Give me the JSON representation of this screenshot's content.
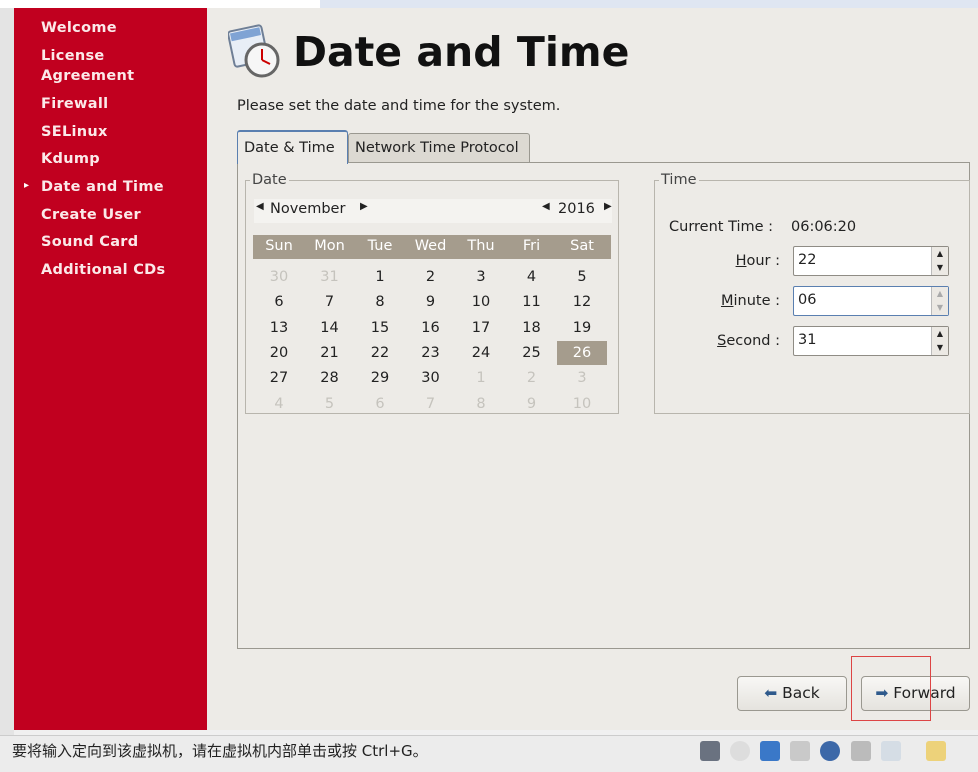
{
  "sidebar": {
    "items": [
      {
        "label": "Welcome"
      },
      {
        "label": "License Agreement"
      },
      {
        "label": "Firewall"
      },
      {
        "label": "SELinux"
      },
      {
        "label": "Kdump"
      },
      {
        "label": "Date and Time",
        "current": true
      },
      {
        "label": "Create User"
      },
      {
        "label": "Sound Card"
      },
      {
        "label": "Additional CDs"
      }
    ]
  },
  "header": {
    "title": "Date and Time",
    "subtitle": "Please set the date and time for the system.",
    "icon": "calendar-clock-icon"
  },
  "tabs": [
    {
      "label": "Date & Time",
      "active": true
    },
    {
      "label": "Network Time Protocol"
    }
  ],
  "date": {
    "legend": "Date",
    "month": "November",
    "year": "2016",
    "weekdays": [
      "Sun",
      "Mon",
      "Tue",
      "Wed",
      "Thu",
      "Fri",
      "Sat"
    ],
    "weeks": [
      [
        "30",
        "31",
        "1",
        "2",
        "3",
        "4",
        "5"
      ],
      [
        "6",
        "7",
        "8",
        "9",
        "10",
        "11",
        "12"
      ],
      [
        "13",
        "14",
        "15",
        "16",
        "17",
        "18",
        "19"
      ],
      [
        "20",
        "21",
        "22",
        "23",
        "24",
        "25",
        "26"
      ],
      [
        "27",
        "28",
        "29",
        "30",
        "1",
        "2",
        "3"
      ],
      [
        "4",
        "5",
        "6",
        "7",
        "8",
        "9",
        "10"
      ]
    ],
    "selected": "26"
  },
  "time": {
    "legend": "Time",
    "current_label": "Current Time :",
    "current_value": "06:06:20",
    "hour_label": "Hour :",
    "hour": "22",
    "minute_label": "Minute :",
    "minute": "06",
    "second_label": "Second :",
    "second": "31"
  },
  "buttons": {
    "back": "Back",
    "forward": "Forward"
  },
  "statusbar": {
    "text": "要将输入定向到该虚拟机，请在虚拟机内部单击或按 Ctrl+G。"
  },
  "colors": {
    "sidebar": "#c1001f",
    "selected_day": "#a59c8d"
  }
}
